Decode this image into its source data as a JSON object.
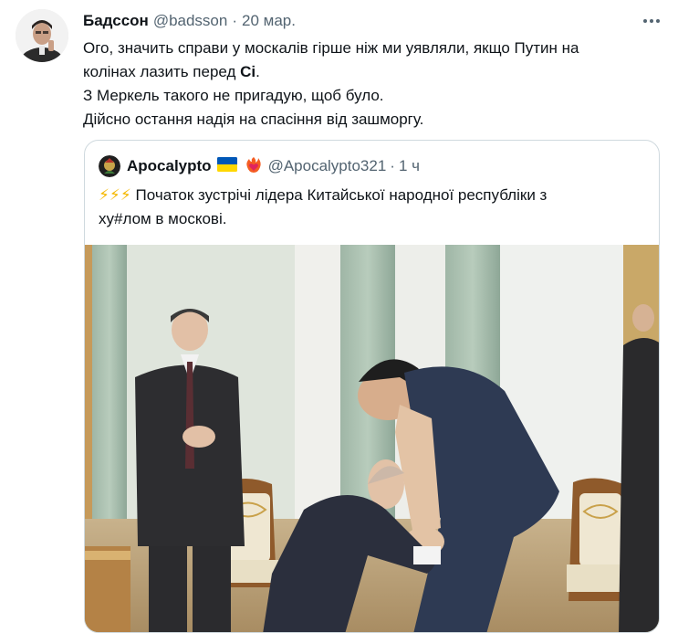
{
  "tweet": {
    "display_name": "Бадссон",
    "handle": "@badsson",
    "separator": "·",
    "date": "20 мар.",
    "text": {
      "line1": "Ого, значить справи у москалів гірше ніж ми уявляли, якщо Путин на",
      "line2_prefix": "колінах лазить перед ",
      "line2_bold": "Сі",
      "line2_suffix": ".",
      "line3": "З Меркель такого не пригадую, щоб було.",
      "line4": "Дійсно остання надія на спасіння від зашморгу."
    },
    "icons": {
      "avatar": "user-avatar",
      "more": "more-options-icon"
    }
  },
  "quote": {
    "display_name": "Apocalypto",
    "handle": "@Apocalypto321",
    "separator": "·",
    "time": "1 ч",
    "bolts": "⚡⚡⚡",
    "text_line1": "Початок зустрічі лідера Китайської народної республіки з",
    "text_line2": "ху#лом в москові.",
    "icons": {
      "avatar": "quote-avatar",
      "flag": "ukraine-flag-icon",
      "badge": "heart-fire-icon"
    }
  },
  "colors": {
    "text": "#0f1419",
    "secondary": "#536471",
    "border": "#cfd9de",
    "bolt": "#f5b800"
  }
}
